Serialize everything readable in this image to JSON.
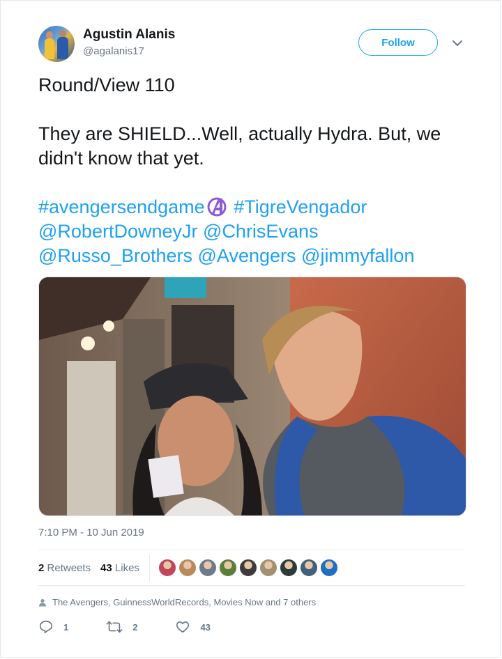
{
  "user": {
    "name": "Agustin Alanis",
    "handle": "@agalanis17"
  },
  "follow_label": "Follow",
  "tweet": {
    "line1": "Round/View 110",
    "line2": "They are SHIELD...Well, actually Hydra. But, we didn't know that yet.",
    "hashtag1": "#avengersendgame",
    "hashtag2": "#TigreVengador",
    "mentions_row1": [
      "@RobertDowneyJr",
      "@ChrisEvans"
    ],
    "mentions_row2": [
      "@Russo_Brothers",
      "@Avengers",
      "@jimmyfallon"
    ]
  },
  "timestamp": "7:10 PM - 10 Jun 2019",
  "stats": {
    "retweets_count": "2",
    "retweets_label": "Retweets",
    "likes_count": "43",
    "likes_label": "Likes"
  },
  "likers": [
    {
      "color": "#c2455a"
    },
    {
      "color": "#b88a5c"
    },
    {
      "color": "#6d7c8a"
    },
    {
      "color": "#5b7d3a"
    },
    {
      "color": "#3c3c3c"
    },
    {
      "color": "#a39070"
    },
    {
      "color": "#2d3b3a"
    },
    {
      "color": "#42617a"
    },
    {
      "color": "#1f6fc2"
    }
  ],
  "context_text": "The Avengers, GuinnessWorldRecords, Movies Now and 7 others",
  "actions": {
    "reply_count": "1",
    "retweet_count": "2",
    "like_count": "43"
  },
  "colors": {
    "accent": "#1da1f2",
    "muted": "#657786",
    "avengers_purple": "#8e5bd6"
  },
  "icons": [
    "chevron-down-icon",
    "avengers-logo-icon",
    "people-icon",
    "reply-icon",
    "retweet-icon",
    "heart-icon"
  ]
}
